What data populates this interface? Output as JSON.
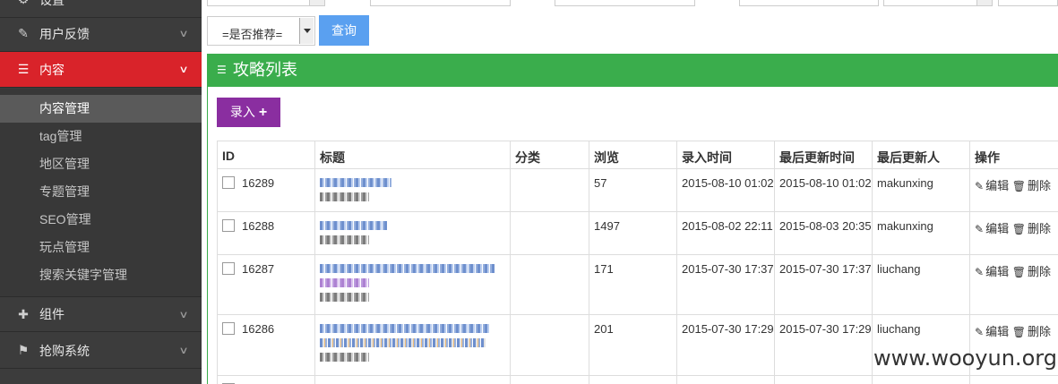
{
  "sidebar": {
    "top_partial": "设置",
    "menu": [
      {
        "label": "用户反馈",
        "icon": "pencil-icon"
      },
      {
        "label": "内容",
        "icon": "list-icon"
      },
      {
        "label": "组件",
        "icon": "plus-icon"
      },
      {
        "label": "抢购系统",
        "icon": "flag-icon"
      }
    ],
    "submenu": [
      "内容管理",
      "tag管理",
      "地区管理",
      "专题管理",
      "SEO管理",
      "玩点管理",
      "搜索关键字管理"
    ]
  },
  "filters": {
    "recommend_select": "=是否推荐=",
    "query_label": "查询"
  },
  "panel": {
    "title": "攻略列表",
    "add_label": "录入"
  },
  "table": {
    "headers": [
      "ID",
      "标题",
      "分类",
      "浏览",
      "录入时间",
      "最后更新时间",
      "最后更新人",
      "操作"
    ],
    "rows": [
      {
        "id": "16289",
        "views": "57",
        "created": "2015-08-10 01:02",
        "updated": "2015-08-10 01:02",
        "user": "makunxing"
      },
      {
        "id": "16288",
        "views": "1497",
        "created": "2015-08-02 22:11",
        "updated": "2015-08-03 20:35",
        "user": "makunxing"
      },
      {
        "id": "16287",
        "views": "171",
        "created": "2015-07-30 17:37",
        "updated": "2015-07-30 17:37",
        "user": "liuchang"
      },
      {
        "id": "16286",
        "views": "201",
        "created": "2015-07-30 17:29",
        "updated": "2015-07-30 17:29",
        "user": "liuchang"
      }
    ],
    "edit_label": "编辑",
    "delete_label": "删除"
  },
  "watermark": "www.wooyun.org"
}
